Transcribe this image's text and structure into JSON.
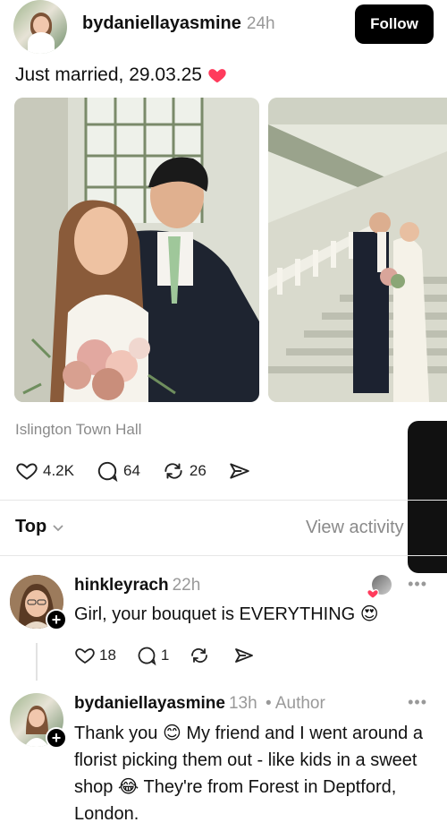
{
  "post": {
    "username": "bydaniellayasmine",
    "time": "24h",
    "follow_label": "Follow",
    "caption": "Just married, 29.03.25",
    "location": "Islington Town Hall",
    "likes": "4.2K",
    "comments": "64",
    "reposts": "26"
  },
  "sort": {
    "label": "Top",
    "view_activity": "View activity"
  },
  "comments": [
    {
      "username": "hinkleyrach",
      "time": "22h",
      "text": "Girl, your bouquet is EVERYTHING 😍",
      "likes": "18",
      "replies": "1"
    },
    {
      "username": "bydaniellayasmine",
      "time": "13h",
      "author_tag": "• Author",
      "text": "Thank you 😊 My friend and I went around a florist picking them out - like kids in a sweet shop 😂 They're from Forest in Deptford, London."
    }
  ],
  "colors": {
    "accent_heart": "#ff3b5c",
    "follow_bg": "#000000",
    "muted_text": "#999999"
  },
  "icons": [
    "heart-icon",
    "comment-icon",
    "repost-icon",
    "share-icon",
    "chevron-down-icon",
    "more-icon",
    "plus-icon"
  ]
}
